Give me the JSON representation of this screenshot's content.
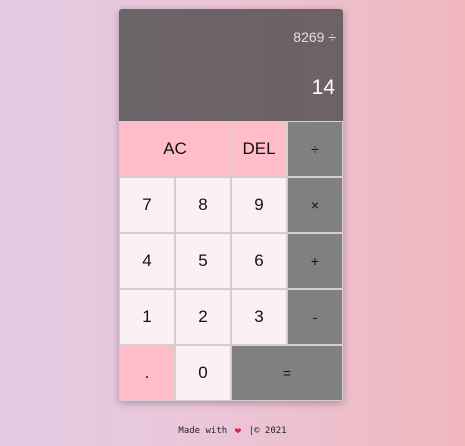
{
  "display": {
    "previous": "8269 ÷",
    "current": "14"
  },
  "keys": {
    "ac": "AC",
    "del": "DEL",
    "divide": "÷",
    "seven": "7",
    "eight": "8",
    "nine": "9",
    "multiply": "×",
    "four": "4",
    "five": "5",
    "six": "6",
    "plus": "+",
    "one": "1",
    "two": "2",
    "three": "3",
    "minus": "-",
    "dot": ".",
    "zero": "0",
    "equals": "="
  },
  "footer": {
    "made_with": "Made with",
    "heart_icon": "heart-icon",
    "copyright": "|© 2021"
  },
  "colors": {
    "display_bg": "#6b6468",
    "pink_key": "#ffbcc9",
    "operator_key": "#808080",
    "number_key": "#fbf1f4"
  }
}
